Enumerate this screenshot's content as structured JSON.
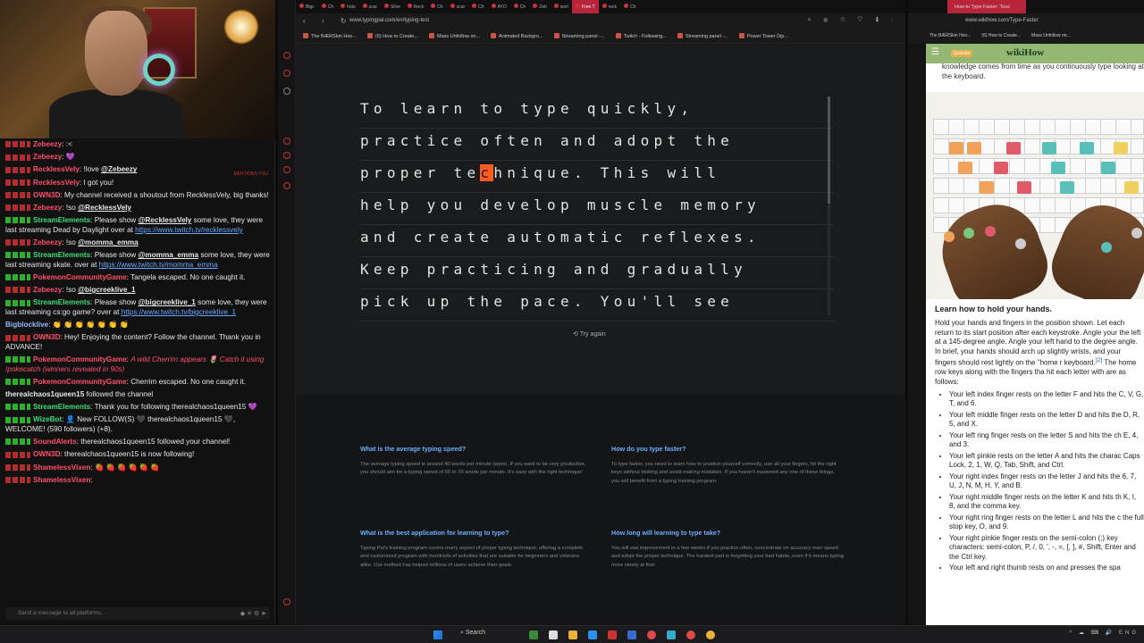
{
  "chat": {
    "messages": [
      {
        "user": "Zebeezy",
        "color": "#ff4f6a",
        "text": ":<",
        "badge": "r"
      },
      {
        "user": "Zebeezy",
        "color": "#ff4f6a",
        "text": "💜",
        "badge": "r"
      },
      {
        "user": "RecklessVely",
        "color": "#ff4f6a",
        "text": "!love ",
        "mention": "@Zebeezy",
        "badge": "r"
      },
      {
        "user": "RecklessVely",
        "color": "#ff4f6a",
        "text": "I got you!",
        "badge": "r"
      },
      {
        "user": "OWN3D",
        "color": "#ff4f6a",
        "text": "My channel received a shoutout from RecklessVely, big thanks!",
        "badge": "r"
      },
      {
        "user": "Zebeezy",
        "color": "#ff4f6a",
        "text": "!so ",
        "mention": "@RecklessVely",
        "badge": "r"
      },
      {
        "user": "StreamElements",
        "color": "#3cdc7a",
        "text": "Please show ",
        "mention": "@RecklessVely",
        "text2": " some love, they were last streaming Dead by Daylight over at ",
        "link": "https://www.twitch.tv/recklessvely",
        "badge": "g"
      },
      {
        "user": "Zebeezy",
        "color": "#ff4f6a",
        "text": "!so ",
        "mention": "@momma_emma",
        "badge": "r"
      },
      {
        "user": "StreamElements",
        "color": "#3cdc7a",
        "text": "Please show ",
        "mention": "@momma_emma",
        "text2": " some love, they were last streaming skate. over at ",
        "link": "https://www.twitch.tv/momma_emma",
        "badge": "g"
      },
      {
        "user": "PokemonCommunityGame",
        "color": "#ff4f6a",
        "text": "Tangela escaped. No one caught it.",
        "badge": "g"
      },
      {
        "user": "Zebeezy",
        "color": "#ff4f6a",
        "text": "!so ",
        "mention": "@bigcreeklive_1",
        "badge": "r"
      },
      {
        "user": "StreamElements",
        "color": "#3cdc7a",
        "text": "Please show ",
        "mention": "@bigcreeklive_1",
        "text2": " some love, they were last streaming cs:go game? over at ",
        "link": "https://www.twitch.tv/bigcreeklive_1",
        "badge": "g"
      },
      {
        "user": "Bigblocklive",
        "color": "#9ab8ff",
        "text": "👏 👏 👏 👏 👏 👏 👏",
        "badge": "none"
      },
      {
        "user": "OWN3D",
        "color": "#ff4f6a",
        "text": "Hey! Enjoying the content? Follow the channel. Thank you in ADVANCE!",
        "badge": "r"
      },
      {
        "user": "PokemonCommunityGame",
        "color": "#ff4f6a",
        "sys": "A wild Cherrim appears 🌷 Catch it using !pokecatch (winners revealed in 90s)",
        "badge": "g"
      },
      {
        "user": "PokemonCommunityGame",
        "color": "#ff4f6a",
        "text": "Cherrim escaped. No one caught it.",
        "badge": "g"
      },
      {
        "user": "therealchaos1queen15",
        "color": "#e8e8e8",
        "text": "followed the channel",
        "badge": "none"
      },
      {
        "user": "StreamElements",
        "color": "#3cdc7a",
        "text": "Thank you for following therealchaos1queen15 💜",
        "badge": "g"
      },
      {
        "user": "WizeBot",
        "color": "#3cdc7a",
        "text": "👤 New FOLLOW(S) 🖤 therealchaos1queen15 🖤, WELCOME! (590 followers) (+8).",
        "badge": "g"
      },
      {
        "user": "SoundAlerts",
        "color": "#ff4f6a",
        "text": "therealchaos1queen15 followed your channel!",
        "badge": "g"
      },
      {
        "user": "OWN3D",
        "color": "#ff4f6a",
        "text": "therealchaos1queen15 is now following!",
        "badge": "r"
      },
      {
        "user": "ShamelessVixen",
        "color": "#ff4f6a",
        "text": "🍓 🍓 🍓 🍓 🍓 🍓",
        "badge": "r"
      },
      {
        "user": "ShamelessVixen",
        "color": "#ff4f6a",
        "text": "",
        "badge": "r"
      }
    ],
    "mention_tag": "MENTIONS YOU",
    "input_placeholder": "Send a message to all platforms..."
  },
  "mid_browser": {
    "tabs": [
      "Bigc",
      "Ch",
      "hots",
      "scar",
      "Silve",
      "Reck",
      "Ch",
      "scar",
      "Ch",
      "AYO",
      "Ch",
      "Zeb",
      "worl",
      "Free T",
      "reck",
      "Ch"
    ],
    "active_tab_index": 13,
    "url": "www.typingpal.com/en/typing-test",
    "bookmarks": [
      "The BÆRSkin Hoo...",
      "(6) How to Create...",
      "Mass Unfollow on...",
      "Animated Backgro...",
      "Streaming panel -...",
      "Twitch - Following...",
      "Streaming panel -...",
      "Power Tower Dip..."
    ]
  },
  "typing": {
    "lines": [
      {
        "before": "To learn to type quickly,",
        "cur": "",
        "after": ""
      },
      {
        "before": "practice often and adopt the",
        "cur": "",
        "after": ""
      },
      {
        "before": "proper te",
        "cur": "c",
        "after": "hnique. This will"
      },
      {
        "before": "help you develop muscle memory",
        "cur": "",
        "after": ""
      },
      {
        "before": "and create automatic reflexes.",
        "cur": "",
        "after": ""
      },
      {
        "before": "Keep practicing and gradually",
        "cur": "",
        "after": ""
      },
      {
        "before": "pick up the pace. You'll see",
        "cur": "",
        "after": ""
      }
    ],
    "try_again": "Try again"
  },
  "faq": [
    {
      "q": "What is the average typing speed?",
      "a": "The average typing speed is around 40 words per minute (wpm). If you want to be very productive, you should aim for a typing speed of 65 to 70 words per minute. It's easy with the right technique!"
    },
    {
      "q": "How do you type faster?",
      "a": "To type faster, you need to learn how to position yourself correctly, use all your fingers, hit the right keys without looking and avoid making mistakes. If you haven't mastered any one of these things, you will benefit from a typing training program."
    },
    {
      "q": "What is the best application for learning to type?",
      "a": "Typing Pal's training program covers every aspect of proper typing technique, offering a complete and customized program with hundreds of activities that are suitable for beginners and veterans alike. Our method has helped millions of users achieve their goals."
    },
    {
      "q": "How long will learning to type take?",
      "a": "You will see improvement in a few weeks if you practice often, concentrate on accuracy over speed and adopt the proper technique. The hardest part is forgetting your bad habits, even if it means typing more slowly at first."
    }
  ],
  "right_browser": {
    "tab_title": "How to Type Faster: Touc",
    "url": "www.wikihow.com/Type-Faster",
    "bookmarks": [
      "The BÆRSkin Hoo...",
      "(6) How to Create...",
      "Mass Unfollow on..."
    ],
    "logo": "wikiHow",
    "quiz_label": "Quizzes",
    "top_text": "knowledge comes from time as you continuously type looking at the keyboard.",
    "heading": "Learn how to hold your hands.",
    "intro": "Hold your hands and fingers in the position shown. Let each return to its start position after each keystroke. Angle your the left at a 145-degree angle. Angle your left hand to the degree angle. In brief, your hands should arch up slightly wrists, and your fingers should rest lightly on the \"home r keyboard.",
    "intro_ref": "[2]",
    "intro2": " The home row keys along with the fingers tha hit each letter with are as follows:",
    "items": [
      "Your left index finger rests on the letter F and hits the C, V, G, T, and 6.",
      "Your left middle finger rests on the letter D and hits the D, R, 5, and X.",
      "Your left ring finger rests on the letter S and hits the ch E, 4, and 3.",
      "Your left pinkie rests on the letter A and hits the charac Caps Lock, 2, 1, W, Q, Tab, Shift, and Ctrl.",
      "Your right index finger rests on the letter J and hits the 6, 7, U, J, N, M, H, Y, and B.",
      "Your right middle finger rests on the letter K and hits th K, I, 8, and the comma key.",
      "Your right ring finger rests on the letter L and hits the c the full stop key, O, and 9.",
      "Your right pinkie finger rests on the semi-colon (;) key characters: semi-colon, P, /, 0, ', -, =, [, ], #, Shift, Enter and the Ctrl key.",
      "Your left and right thumb rests on and presses the spa"
    ]
  },
  "taskbar": {
    "search": "Search",
    "tray": "^ ☁ ⌨ 🔊 ENG"
  },
  "colors": {
    "accent": "#b8243a",
    "cursor": "#ff5a1f",
    "link": "#6ab0ff",
    "wikihow_green": "#93b874"
  }
}
